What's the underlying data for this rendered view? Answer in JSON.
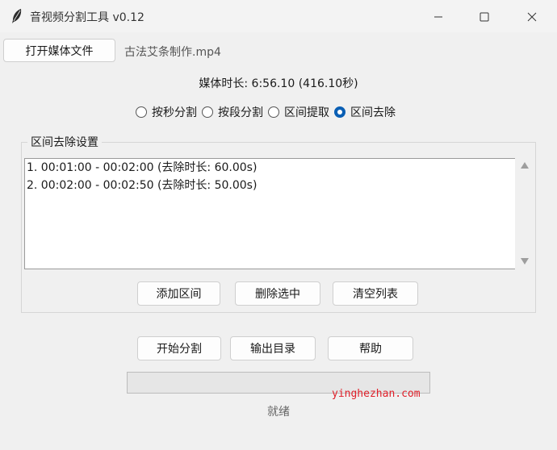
{
  "window": {
    "title": "音视频分割工具 v0.12",
    "icon": "feather-icon",
    "controls": [
      "minimize-icon",
      "maximize-icon",
      "close-icon"
    ]
  },
  "toolbar": {
    "open_button": "打开媒体文件",
    "filename": "古法艾条制作.mp4"
  },
  "media": {
    "duration_text": "媒体时长: 6:56.10 (416.10秒)"
  },
  "modes": {
    "options": [
      "按秒分割",
      "按段分割",
      "区间提取",
      "区间去除"
    ],
    "selected": "区间去除"
  },
  "group": {
    "label": "区间去除设置",
    "items": [
      "1. 00:01:00 - 00:02:00 (去除时长: 60.00s)",
      "2. 00:02:00 - 00:02:50 (去除时长: 50.00s)"
    ],
    "buttons": {
      "add": "添加区间",
      "delete": "删除选中",
      "clear": "清空列表"
    }
  },
  "actions": {
    "start": "开始分割",
    "output": "输出目录",
    "help": "帮助"
  },
  "progress": {
    "value": 0
  },
  "status": {
    "text": "就绪"
  },
  "watermark": "yinghezhan.com",
  "colors": {
    "accent": "#0a5fb4",
    "background": "#f0f0f0",
    "watermark": "#e0202a"
  }
}
